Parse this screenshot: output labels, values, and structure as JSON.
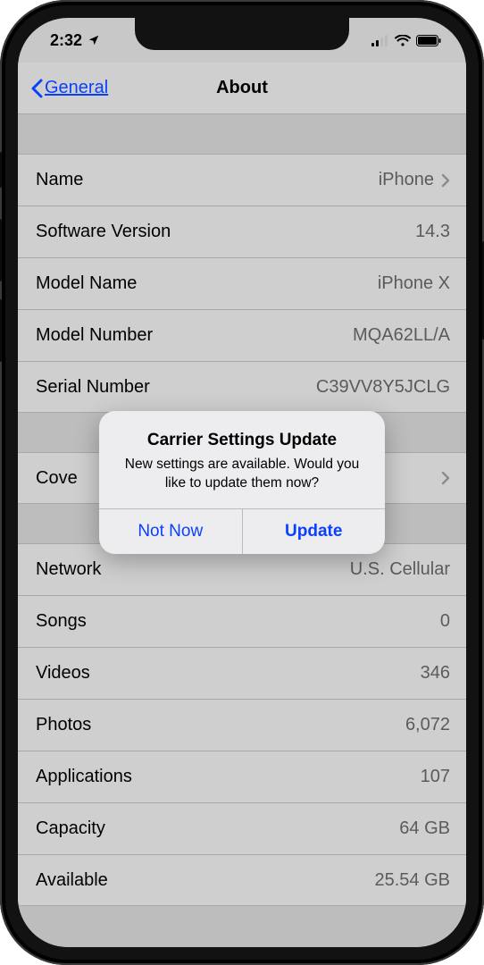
{
  "status": {
    "time": "2:32",
    "signal_bars": 2,
    "wifi": true,
    "battery_full": true
  },
  "nav": {
    "back_label": "General",
    "title": "About"
  },
  "group1": [
    {
      "label": "Name",
      "value": "iPhone",
      "chevron": true
    },
    {
      "label": "Software Version",
      "value": "14.3"
    },
    {
      "label": "Model Name",
      "value": "iPhone X"
    },
    {
      "label": "Model Number",
      "value": "MQA62LL/A"
    },
    {
      "label": "Serial Number",
      "value": "C39VV8Y5JCLG"
    }
  ],
  "group2": [
    {
      "label": "Cove",
      "value": "",
      "chevron": true
    }
  ],
  "group3": [
    {
      "label": "Network",
      "value": "U.S. Cellular"
    },
    {
      "label": "Songs",
      "value": "0"
    },
    {
      "label": "Videos",
      "value": "346"
    },
    {
      "label": "Photos",
      "value": "6,072"
    },
    {
      "label": "Applications",
      "value": "107"
    },
    {
      "label": "Capacity",
      "value": "64 GB"
    },
    {
      "label": "Available",
      "value": "25.54 GB"
    }
  ],
  "modal": {
    "title": "Carrier Settings Update",
    "message": "New settings are available. Would you like to update them now?",
    "cancel": "Not Now",
    "confirm": "Update"
  }
}
